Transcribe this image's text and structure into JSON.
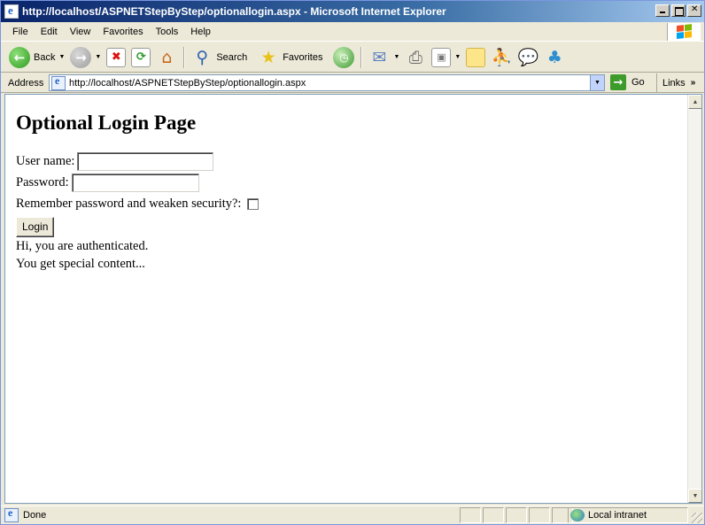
{
  "window": {
    "title": "http://localhost/ASPNETStepByStep/optionallogin.aspx - Microsoft Internet Explorer"
  },
  "menu": {
    "items": [
      {
        "key": "F",
        "rest": "ile"
      },
      {
        "key": "E",
        "rest": "dit"
      },
      {
        "key": "V",
        "rest": "iew"
      },
      {
        "key": "F",
        "rest": "avorites",
        "prefix": ""
      },
      {
        "key": "T",
        "rest": "ools"
      },
      {
        "key": "H",
        "rest": "elp"
      }
    ],
    "labels": [
      "File",
      "Edit",
      "View",
      "Favorites",
      "Tools",
      "Help"
    ]
  },
  "toolbar": {
    "back_label": "Back",
    "search_label": "Search",
    "favorites_label": "Favorites"
  },
  "address": {
    "label": "Address",
    "url": "http://localhost/ASPNETStepByStep/optionallogin.aspx",
    "go_label": "Go",
    "links_label": "Links"
  },
  "page": {
    "heading": "Optional Login Page",
    "username_label": "User name:",
    "username_value": "",
    "password_label": "Password:",
    "password_value": "",
    "remember_label": "Remember password and weaken security?:",
    "remember_checked": false,
    "login_button": "Login",
    "message_1": "Hi, you are authenticated.",
    "message_2": "You get special content..."
  },
  "status": {
    "text": "Done",
    "zone": "Local intranet"
  }
}
